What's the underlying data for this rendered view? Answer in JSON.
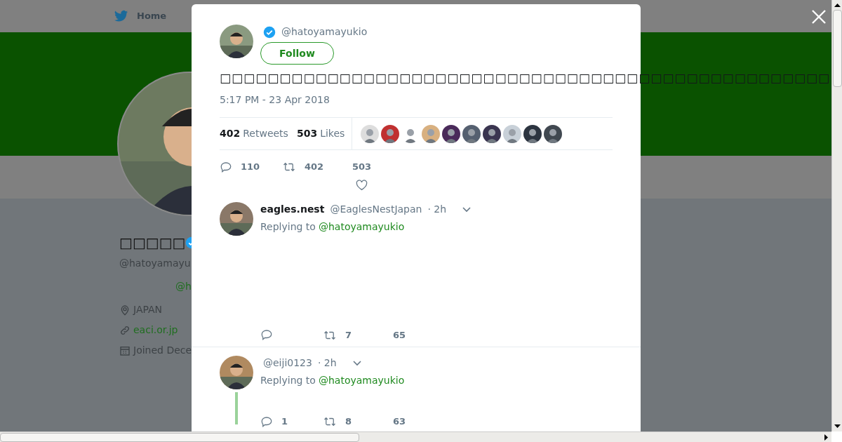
{
  "background": {
    "nav": {
      "home": "Home"
    },
    "profile": {
      "name": "□□□□□",
      "verified": true,
      "handle": "@hatoyamayu",
      "mention": "@h",
      "location": "JAPAN",
      "website": "eaci.or.jp",
      "joined": "Joined Dece"
    }
  },
  "tweet": {
    "handle": "@hatoyamayukio",
    "verified": true,
    "follow": "Follow",
    "text": "□□□□□□□□□□□□□□□□□□□□□□□□□□□□□□□□□□□□□□□□□□□□□□□□□□□",
    "time": "5:17 PM - 23 Apr 2018",
    "stats": [
      {
        "count": "402",
        "label": "Retweets"
      },
      {
        "count": "503",
        "label": "Likes"
      }
    ],
    "actions": {
      "replies": "110",
      "retweets": "402",
      "likes": "503"
    }
  },
  "replies": [
    {
      "name": "eagles.nest",
      "handle": "@EaglesNestJapan",
      "time": "· 2h",
      "replying_label": "Replying to",
      "replying_to": "@hatoyamayukio",
      "retweets": "7",
      "likes": "65",
      "thread": false
    },
    {
      "handle": "@eiji0123",
      "time": "· 2h",
      "replying_label": "Replying to",
      "replying_to": "@hatoyamayukio",
      "replies": "1",
      "retweets": "8",
      "likes": "63",
      "thread": true
    }
  ]
}
